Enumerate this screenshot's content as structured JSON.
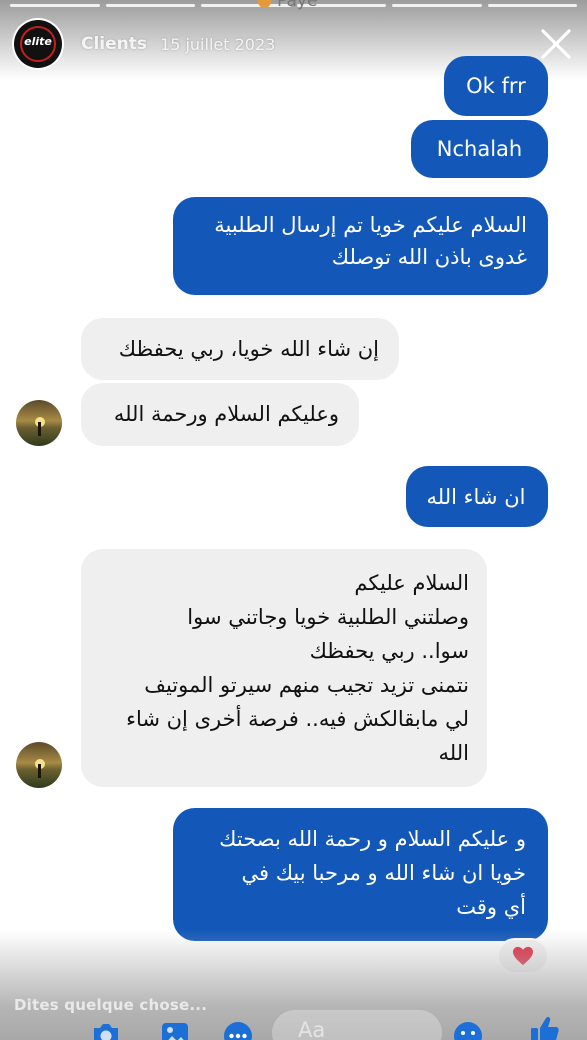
{
  "story": {
    "progress_segments": 6,
    "previous_caption": "Paye",
    "channel": {
      "name": "Clients",
      "date": "15 juillet 2023",
      "logo_text": "elite"
    }
  },
  "messages": [
    {
      "side": "sent",
      "text": "Ok frr"
    },
    {
      "side": "sent",
      "text": "Nchalah"
    },
    {
      "side": "sent",
      "lines": [
        "السلام عليكم خويا تم إرسال الطلبية",
        "غدوى باذن الله توصلك"
      ]
    },
    {
      "side": "received",
      "text": "إن شاء الله خويا، ربي يحفظك"
    },
    {
      "side": "received",
      "text": "وعليكم السلام ورحمة الله"
    },
    {
      "side": "sent",
      "text": "ان شاء الله"
    },
    {
      "side": "received",
      "lines": [
        "السلام عليكم",
        "وصلتني الطلبية خويا وجاتني سوا",
        "سوا.. ربي يحفظك",
        "نتمنى تزيد تجيب منهم سيرتو الموتيف",
        "لي مابقالكش فيه.. فرصة أخرى إن شاء",
        "الله"
      ]
    },
    {
      "side": "sent",
      "lines": [
        "و عليكم السلام و رحمة الله بصحتك",
        "خويا ان شاء الله و مرحبا بيك في",
        "أي وقت"
      ],
      "reaction": "heart-icon"
    }
  ],
  "composer": {
    "placeholder": "Dites quelque chose...",
    "input_hint": "Aa",
    "icons": [
      "camera-icon",
      "image-icon",
      "more-icon",
      "emoji-icon",
      "like-icon"
    ]
  },
  "colors": {
    "sent_bubble": "#1358b8",
    "received_bubble": "#efefef",
    "reaction_heart": "#e0243b",
    "logo_ring": "#c41e1e"
  }
}
